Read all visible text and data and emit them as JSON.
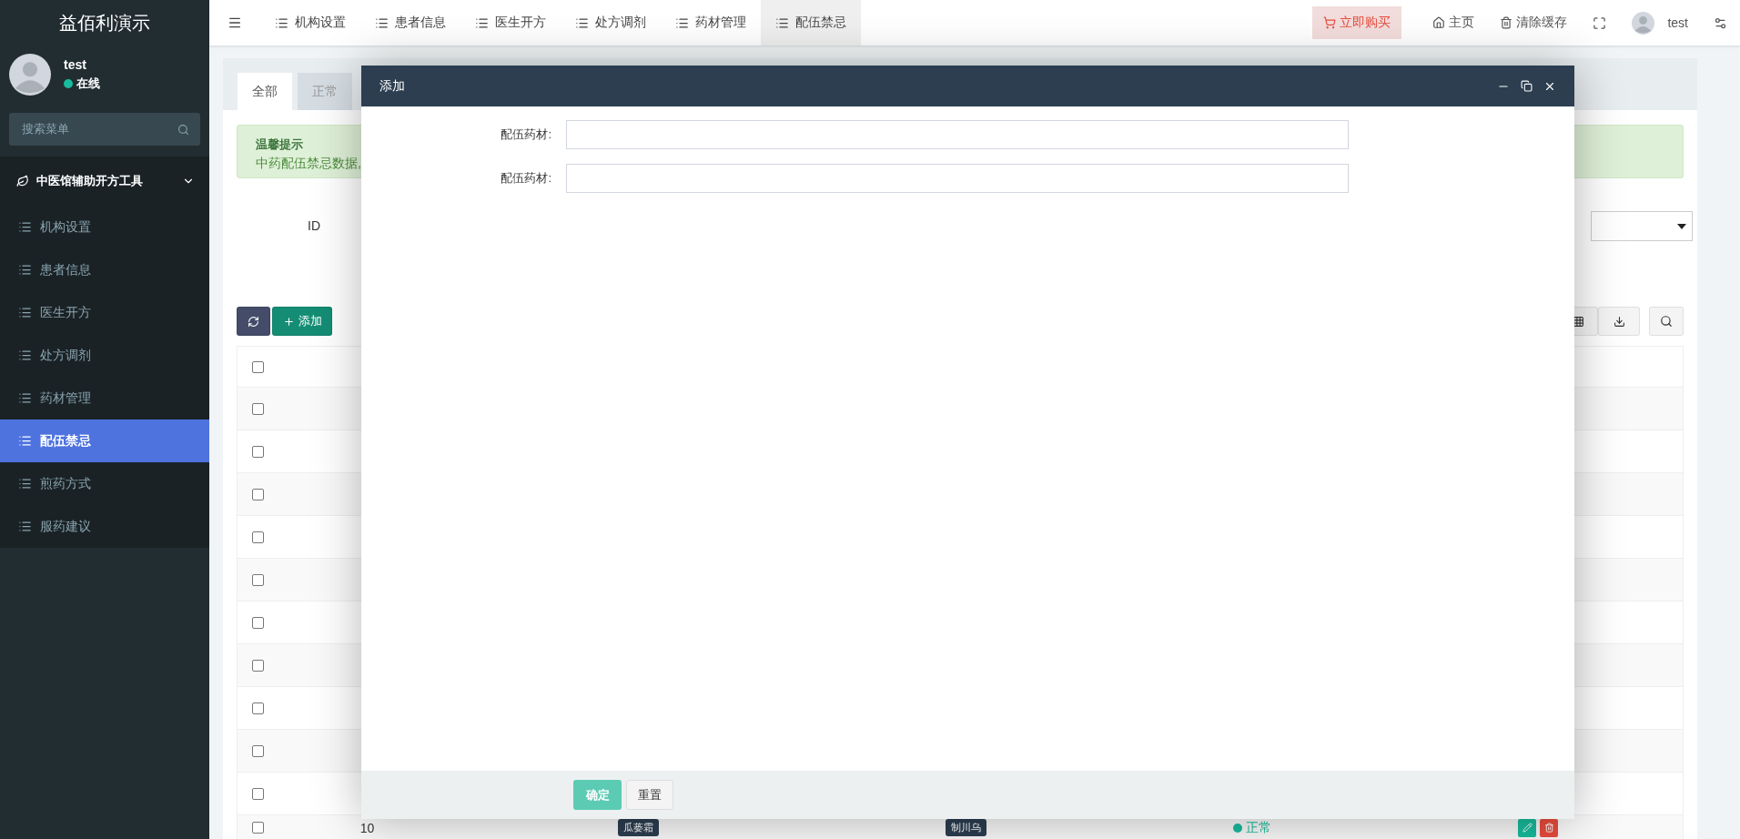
{
  "sidebar": {
    "logo": "益佰利演示",
    "user": {
      "name": "test",
      "status": "在线"
    },
    "search": {
      "placeholder": "搜索菜单"
    },
    "section": {
      "label": "中医馆辅助开方工具",
      "expanded": true
    },
    "items": [
      {
        "label": "机构设置",
        "selected": false
      },
      {
        "label": "患者信息",
        "selected": false
      },
      {
        "label": "医生开方",
        "selected": false
      },
      {
        "label": "处方调剂",
        "selected": false
      },
      {
        "label": "药材管理",
        "selected": false
      },
      {
        "label": "配伍禁忌",
        "selected": true
      },
      {
        "label": "煎药方式",
        "selected": false
      },
      {
        "label": "服药建议",
        "selected": false
      }
    ]
  },
  "top_tabs": [
    {
      "label": "机构设置",
      "selected": false
    },
    {
      "label": "患者信息",
      "selected": false
    },
    {
      "label": "医生开方",
      "selected": false
    },
    {
      "label": "处方调剂",
      "selected": false
    },
    {
      "label": "药材管理",
      "selected": false
    },
    {
      "label": "配伍禁忌",
      "selected": true
    }
  ],
  "top_actions": {
    "buy": "立即购买",
    "home": "主页",
    "clear_cache": "清除缓存",
    "user": "test"
  },
  "page_tabs": [
    {
      "label": "全部",
      "selected": true
    },
    {
      "label": "正常",
      "selected": false
    }
  ],
  "notice": {
    "title": "温馨提示",
    "text": "中药配伍禁忌数据,"
  },
  "search_form": {
    "id_label": "ID"
  },
  "toolbar": {
    "add": "添加"
  },
  "table": {
    "header_checked": false,
    "rows": [
      {
        "checked": false
      },
      {
        "checked": false
      },
      {
        "checked": false
      },
      {
        "checked": false
      },
      {
        "checked": false
      },
      {
        "checked": false
      },
      {
        "checked": false
      },
      {
        "checked": false
      },
      {
        "checked": false
      },
      {
        "checked": false
      },
      {
        "checked": false,
        "id": "10",
        "herb_1": "瓜蒌霜",
        "herb_2": "制川乌",
        "status": "正常"
      }
    ]
  },
  "dialog": {
    "title": "添加",
    "fields": [
      {
        "label": "配伍药材:"
      },
      {
        "label": "配伍药材:"
      }
    ],
    "confirm": "确定",
    "reset": "重置"
  }
}
